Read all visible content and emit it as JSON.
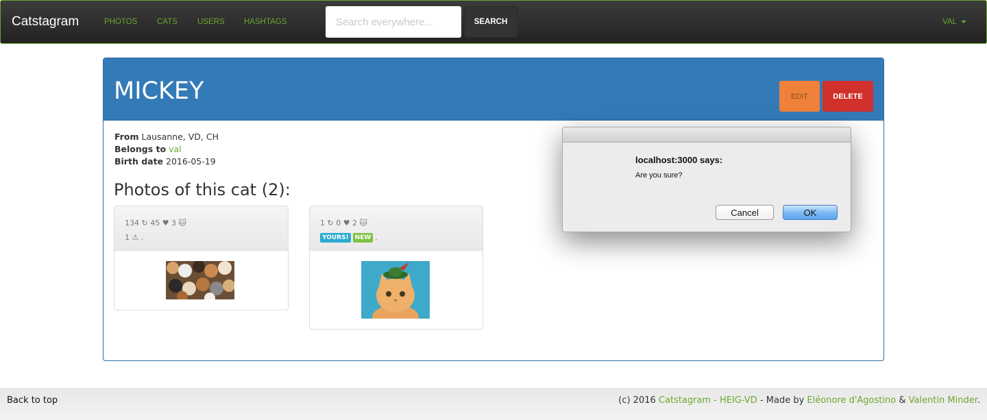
{
  "navbar": {
    "brand": "Catstagram",
    "links": [
      "PHOTOS",
      "CATS",
      "USERS",
      "HASHTAGS"
    ],
    "search_placeholder": "Search everywhere...",
    "search_button": "SEARCH",
    "user_menu": "VAL",
    "accent_color": "#6aa82e"
  },
  "cat": {
    "name": "MICKEY",
    "edit_label": "EDIT",
    "delete_label": "DELETE",
    "from_label": "From",
    "from_value": "Lausanne, VD, CH",
    "belongs_label": "Belongs to",
    "belongs_value": "val",
    "birth_label": "Birth date",
    "birth_value": "2016-05-19",
    "photos_heading": "Photos of this cat (2):"
  },
  "photos": [
    {
      "stats_line": "134 ↻ 45 ♥ 3 🐱",
      "second_line": "1 ⚠ .",
      "badges": []
    },
    {
      "stats_line": "1 ↻ 0 ♥ 2 🐱",
      "second_line": ".",
      "badges": [
        "YOURS!",
        "NEW"
      ]
    }
  ],
  "footer": {
    "back_to_top": "Back to top",
    "copyright_prefix": "(c) 2016",
    "site_link": "Catstagram - HEIG-VD",
    "made_by": "- Made by",
    "author1": "Eléonore d'Agostino",
    "amp": "&",
    "author2": "Valentin Minder",
    "period": "."
  },
  "dialog": {
    "heading": "localhost:3000 says:",
    "message": "Are you sure?",
    "cancel_label": "Cancel",
    "ok_label": "OK"
  }
}
